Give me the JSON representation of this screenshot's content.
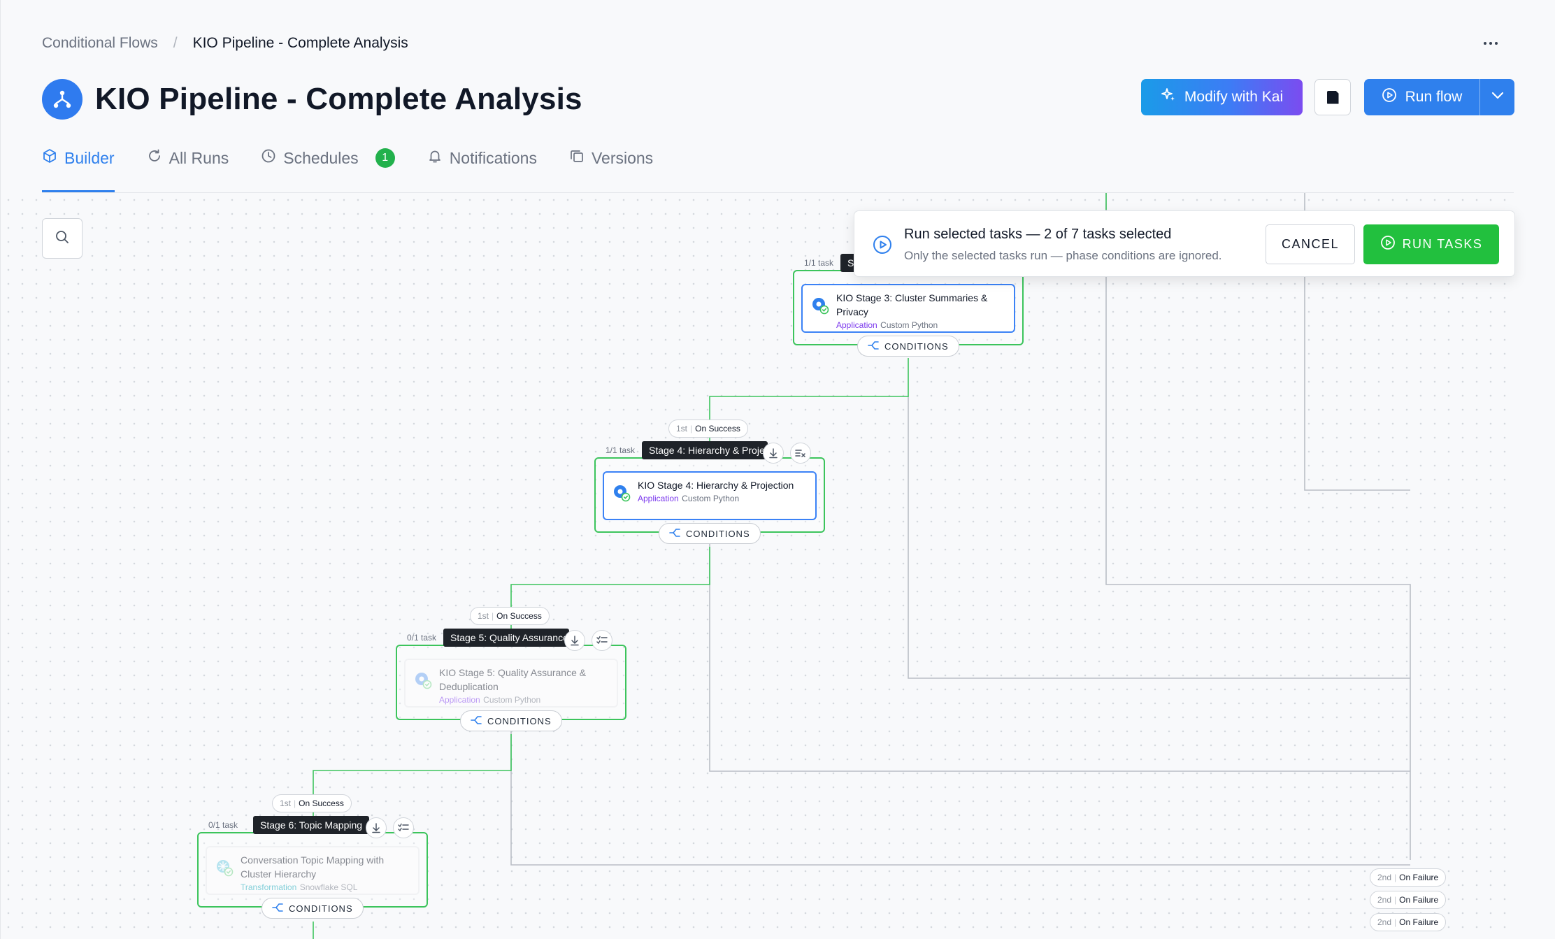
{
  "breadcrumb": {
    "parent": "Conditional Flows",
    "separator": "/",
    "current": "KIO Pipeline - Complete Analysis"
  },
  "page": {
    "title": "KIO Pipeline - Complete Analysis"
  },
  "actions": {
    "modify_label": "Modify with Kai",
    "run_label": "Run flow",
    "save_icon": "save-icon",
    "more_icon": "more-horizontal-icon"
  },
  "tabs": [
    {
      "label": "Builder",
      "icon": "cube-icon",
      "active": true
    },
    {
      "label": "All Runs",
      "icon": "refresh-icon"
    },
    {
      "label": "Schedules",
      "icon": "clock-icon",
      "badge": "1"
    },
    {
      "label": "Notifications",
      "icon": "bell-icon"
    },
    {
      "label": "Versions",
      "icon": "copy-icon"
    }
  ],
  "run_bar": {
    "title": "Run selected tasks — 2 of 7 tasks selected",
    "subtitle": "Only the selected tasks run — phase conditions are ignored.",
    "cancel_label": "CANCEL",
    "run_label": "RUN TASKS"
  },
  "phases": [
    {
      "count": "1/1 task",
      "label": "S",
      "task_title": "KIO Stage 3: Cluster Summaries & Privacy",
      "task_type": "Application",
      "task_meta": "Custom Python",
      "conditions_label": "CONDITIONS"
    },
    {
      "count": "1/1 task",
      "label": "Stage 4: Hierarchy & Projection",
      "task_title": "KIO Stage 4: Hierarchy & Projection",
      "task_type": "Application",
      "task_meta": "Custom Python",
      "conditions_label": "CONDITIONS"
    },
    {
      "count": "0/1 task",
      "label": "Stage 5: Quality Assurance",
      "task_title": "KIO Stage 5: Quality Assurance & Deduplication",
      "task_type": "Application",
      "task_meta": "Custom Python",
      "conditions_label": "CONDITIONS"
    },
    {
      "count": "0/1 task",
      "label": "Stage 6: Topic Mapping",
      "task_title": "Conversation Topic Mapping with Cluster Hierarchy",
      "task_type": "Transformation",
      "task_meta": "Snowflake SQL",
      "conditions_label": "CONDITIONS"
    }
  ],
  "edge_labels": {
    "success": [
      {
        "order": "1st",
        "text": "On Success"
      },
      {
        "order": "1st",
        "text": "On Success"
      },
      {
        "order": "1st",
        "text": "On Success"
      }
    ],
    "failure": [
      {
        "order": "2nd",
        "text": "On Failure"
      },
      {
        "order": "2nd",
        "text": "On Failure"
      },
      {
        "order": "2nd",
        "text": "On Failure"
      }
    ]
  },
  "colors": {
    "primary": "#2f80ed",
    "success": "#22c03e",
    "phase_border": "#3cc45c",
    "application": "#7c3aed",
    "transformation": "#0ea5b7"
  }
}
